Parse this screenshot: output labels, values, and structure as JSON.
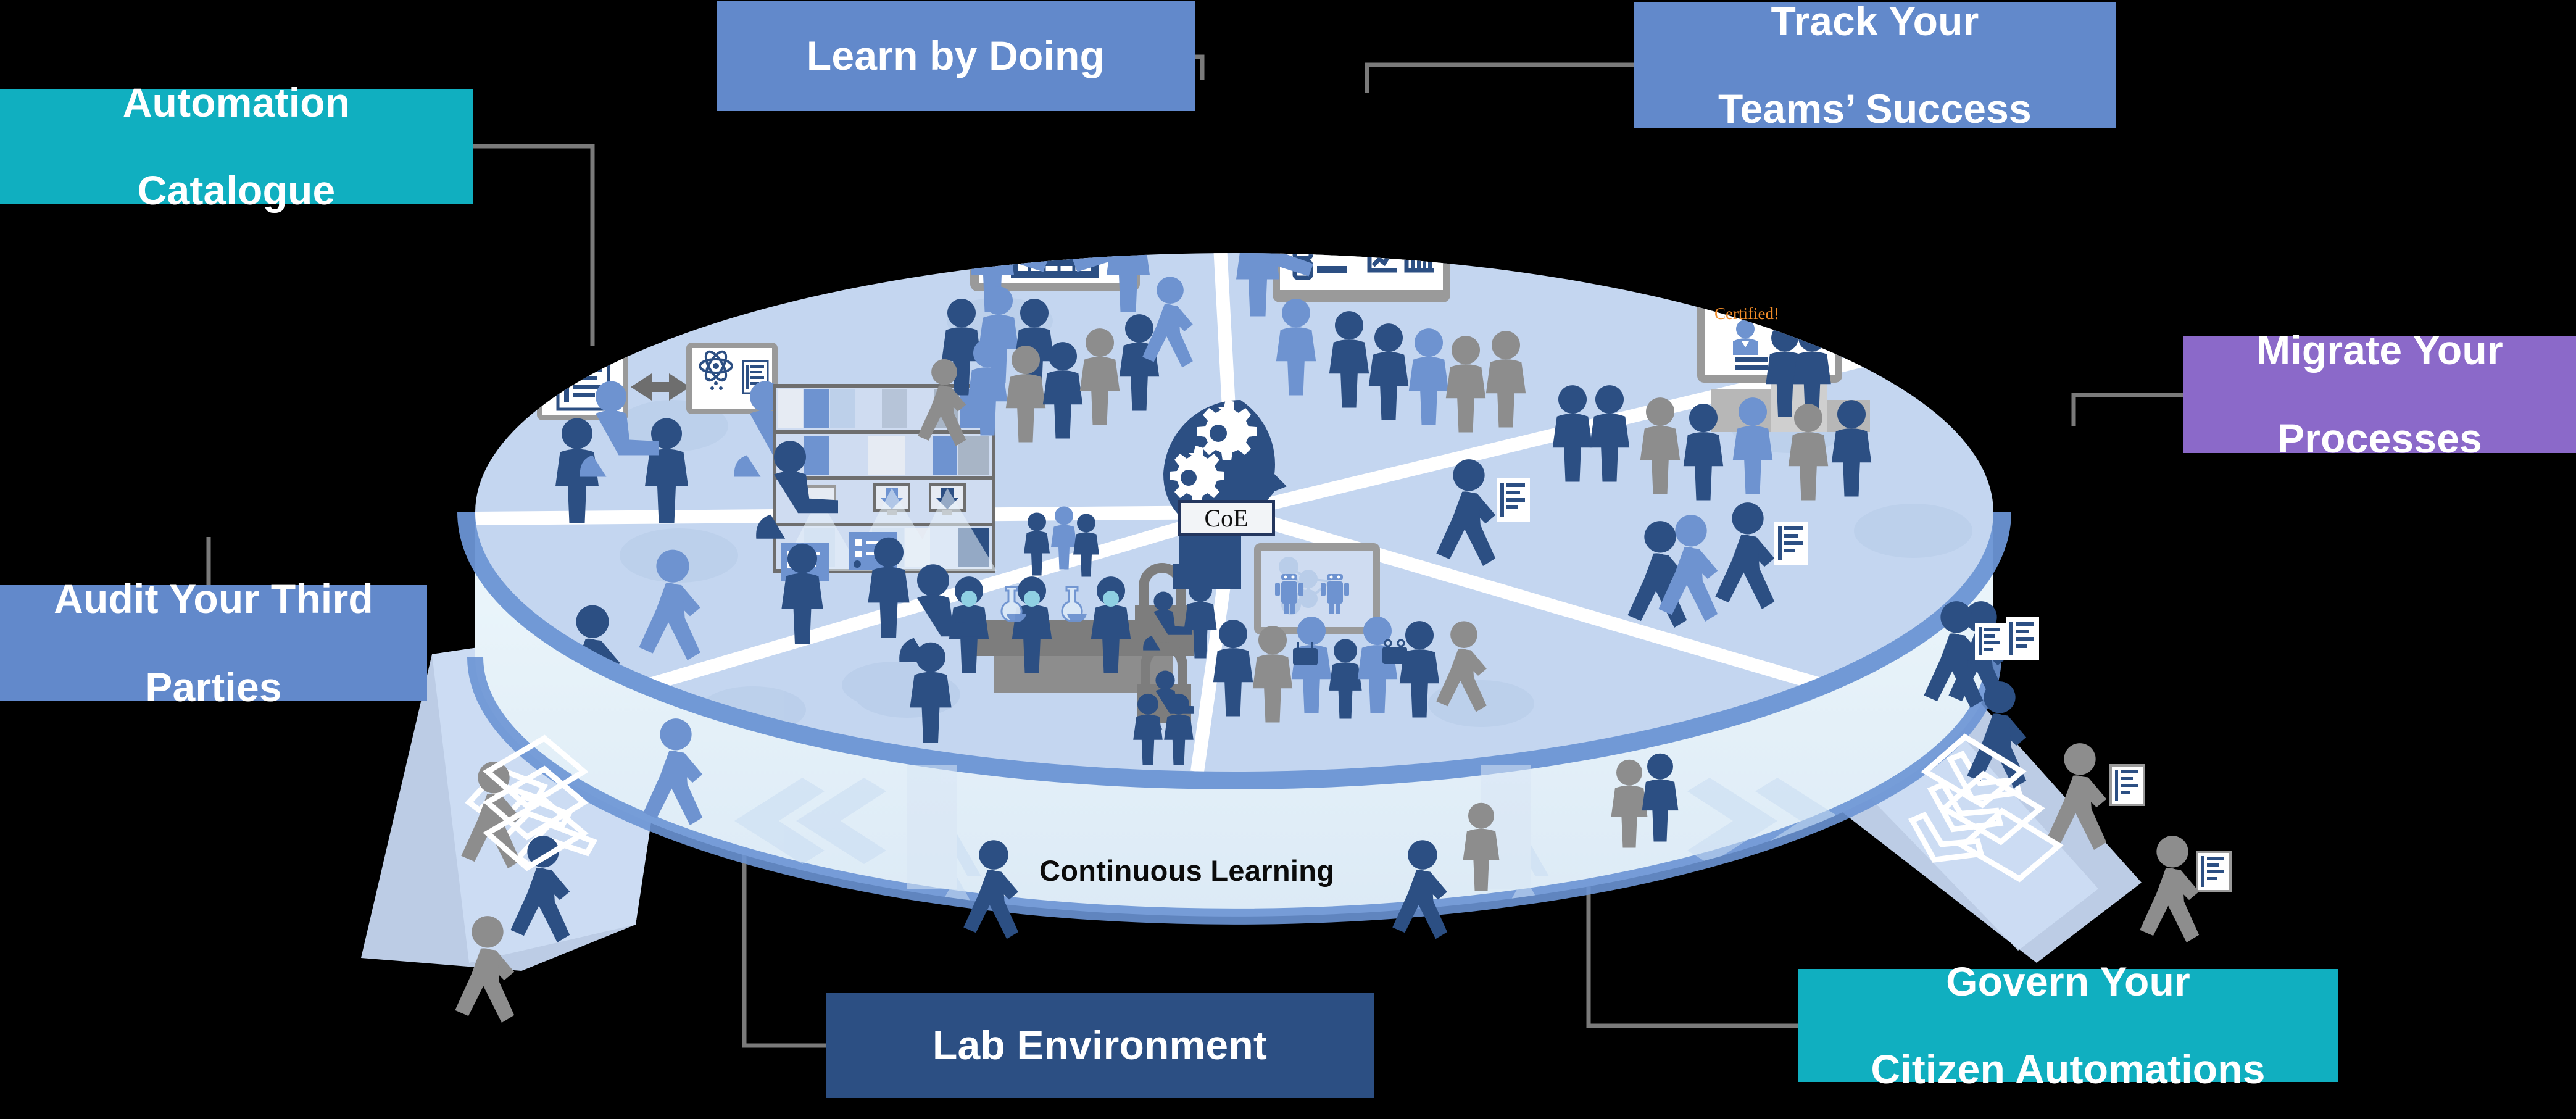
{
  "diagram": {
    "title_center": "CoE",
    "ring_label": "Continuous Learning",
    "badge_caption": "Certified!",
    "colors": {
      "teal": "#10afc0",
      "medium_blue": "#6289cb",
      "purple": "#8b69c9",
      "navy": "#2c4f83",
      "deep_navy": "#24365e",
      "plate_light": "#c7d8f0",
      "plate_rim": "#6a93d4",
      "ring_band": "#e3f1f8",
      "connector_gray": "#7a7a7a",
      "background": "#000000",
      "orange": "#f28c28"
    },
    "callouts": [
      {
        "id": "automation-catalogue",
        "label": "Automation\nCatalogue",
        "line1": "Automation",
        "line2": "Catalogue",
        "color": "teal"
      },
      {
        "id": "learn-by-doing",
        "label": "Learn by Doing",
        "line1": "Learn by Doing",
        "line2": "",
        "color": "medium_blue"
      },
      {
        "id": "track-teams-success",
        "label": "Track Your Teams’ Success",
        "line1": "Track Your",
        "line2": "Teams’ Success",
        "color": "medium_blue"
      },
      {
        "id": "migrate-processes",
        "label": "Migrate Your Processes",
        "line1": "Migrate Your",
        "line2": "Processes",
        "color": "purple"
      },
      {
        "id": "audit-third-parties",
        "label": "Audit Your Third Parties",
        "line1": "Audit Your Third",
        "line2": "Parties",
        "color": "medium_blue"
      },
      {
        "id": "lab-environment",
        "label": "Lab Environment",
        "line1": "Lab Environment",
        "line2": "",
        "color": "navy"
      },
      {
        "id": "govern-citizen",
        "label": "Govern Your Citizen Automations",
        "line1": "Govern Your",
        "line2": "Citizen Automations",
        "color": "teal"
      }
    ],
    "segments": [
      {
        "name": "catalogue-segment",
        "icons": [
          "document-list-screen",
          "atom-screen",
          "bidirectional-arrow-icon"
        ]
      },
      {
        "name": "learning-segment",
        "icons": [
          "whiteboard-gantt-screen",
          "presenter-figure"
        ]
      },
      {
        "name": "tracking-segment",
        "icons": [
          "dashboard-screen",
          "certificate-screen",
          "award-ribbon-icon"
        ]
      },
      {
        "name": "audit-segment",
        "icons": [
          "server-archive-rack",
          "monitor-download-icon"
        ]
      },
      {
        "name": "lab-segment",
        "icons": [
          "lab-bench-icon",
          "flask-icon",
          "padlock-icon"
        ]
      },
      {
        "name": "governance-segment",
        "icons": [
          "network-robot-screen",
          "remote-control-icon"
        ]
      }
    ],
    "ramps": [
      {
        "name": "left-ramp",
        "direction": "inbound",
        "chevron": "chevron-up-right"
      },
      {
        "name": "right-ramp",
        "direction": "outbound",
        "chevron": "chevron-down-right"
      }
    ]
  }
}
